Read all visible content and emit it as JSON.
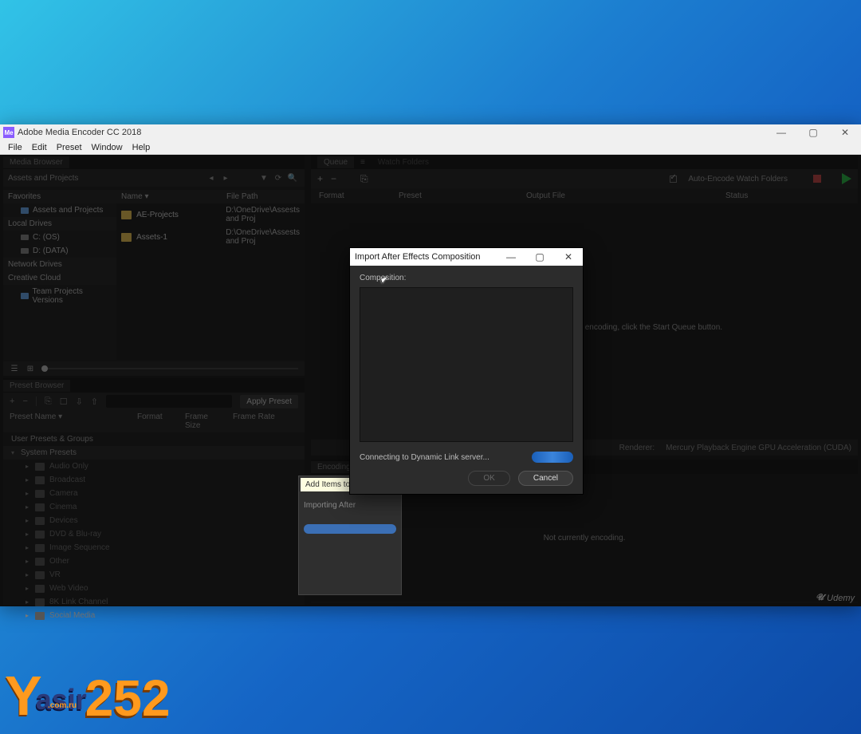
{
  "app": {
    "title": "Adobe Media Encoder CC 2018"
  },
  "menu": {
    "file": "File",
    "edit": "Edit",
    "preset": "Preset",
    "window": "Window",
    "help": "Help"
  },
  "window_controls": {
    "min": "—",
    "max": "▢",
    "close": "✕"
  },
  "media_browser": {
    "tab": "Media Browser",
    "crumb": "Assets and Projects",
    "nav_prev": "◂",
    "nav_next": "▸",
    "icon_filter": "▼",
    "icon_refresh": "⟳",
    "icon_search": "🔍",
    "col_name": "Name ▾",
    "col_path": "File Path",
    "favorites": "Favorites",
    "fav_item": "Assets and Projects",
    "local_drives": "Local Drives",
    "drive_c": "C: (OS)",
    "drive_d": "D: (DATA)",
    "network_drives": "Network Drives",
    "creative_cloud": "Creative Cloud",
    "team_projects": "Team Projects Versions",
    "rows": [
      {
        "name": "AE-Projects",
        "path": "D:\\OneDrive\\Assests and Proj"
      },
      {
        "name": "Assets-1",
        "path": "D:\\OneDrive\\Assests and Proj"
      }
    ],
    "view_list": "☰",
    "view_grid": "⊞"
  },
  "preset_browser": {
    "tab": "Preset Browser",
    "btn_add": "+",
    "btn_minus": "−",
    "btn_dup": "⎘",
    "btn_new": "☐",
    "btn_imp": "⇩",
    "btn_exp": "⇧",
    "apply": "Apply Preset",
    "col_name": "Preset Name ▾",
    "col_fmt": "Format",
    "col_fs": "Frame Size",
    "col_fr": "Frame Rate",
    "user_group": "User Presets & Groups",
    "system": "System Presets",
    "items": [
      "Audio Only",
      "Broadcast",
      "Camera",
      "Cinema",
      "Devices",
      "DVD & Blu-ray",
      "Image Sequence",
      "Other",
      "VR",
      "Web Video",
      "8K Link Channel",
      "Social Media"
    ]
  },
  "queue": {
    "tab1": "Queue",
    "tab2": "Watch Folders",
    "btn_add": "+",
    "btn_minus": "−",
    "btn_dup": "⎘",
    "auto_label": "Auto-Encode Watch Folders",
    "col_format": "Format",
    "col_preset": "Preset",
    "col_output": "Output File",
    "col_status": "Status",
    "hint": "the Media Browser or desktop.  To start encoding, click the Start Queue button.",
    "footer_renderer_label": "Renderer:",
    "footer_renderer_value": "Mercury Playback Engine GPU Acceleration (CUDA)"
  },
  "encoding": {
    "tab": "Encoding",
    "idle": "Not currently encoding."
  },
  "bg_popup": {
    "tip": "Add Items to Qu",
    "txt": "Importing After"
  },
  "modal": {
    "title": "Import After Effects Composition",
    "label": "Composition:",
    "status": "Connecting to Dynamic Link server...",
    "ok": "OK",
    "cancel": "Cancel",
    "min": "—",
    "max": "▢",
    "close": "✕"
  },
  "branding": {
    "udemy": "Udemy"
  },
  "watermark": {
    "y": "Y",
    "asir": "asir",
    "num": "252",
    "sub": ".com.ru"
  }
}
